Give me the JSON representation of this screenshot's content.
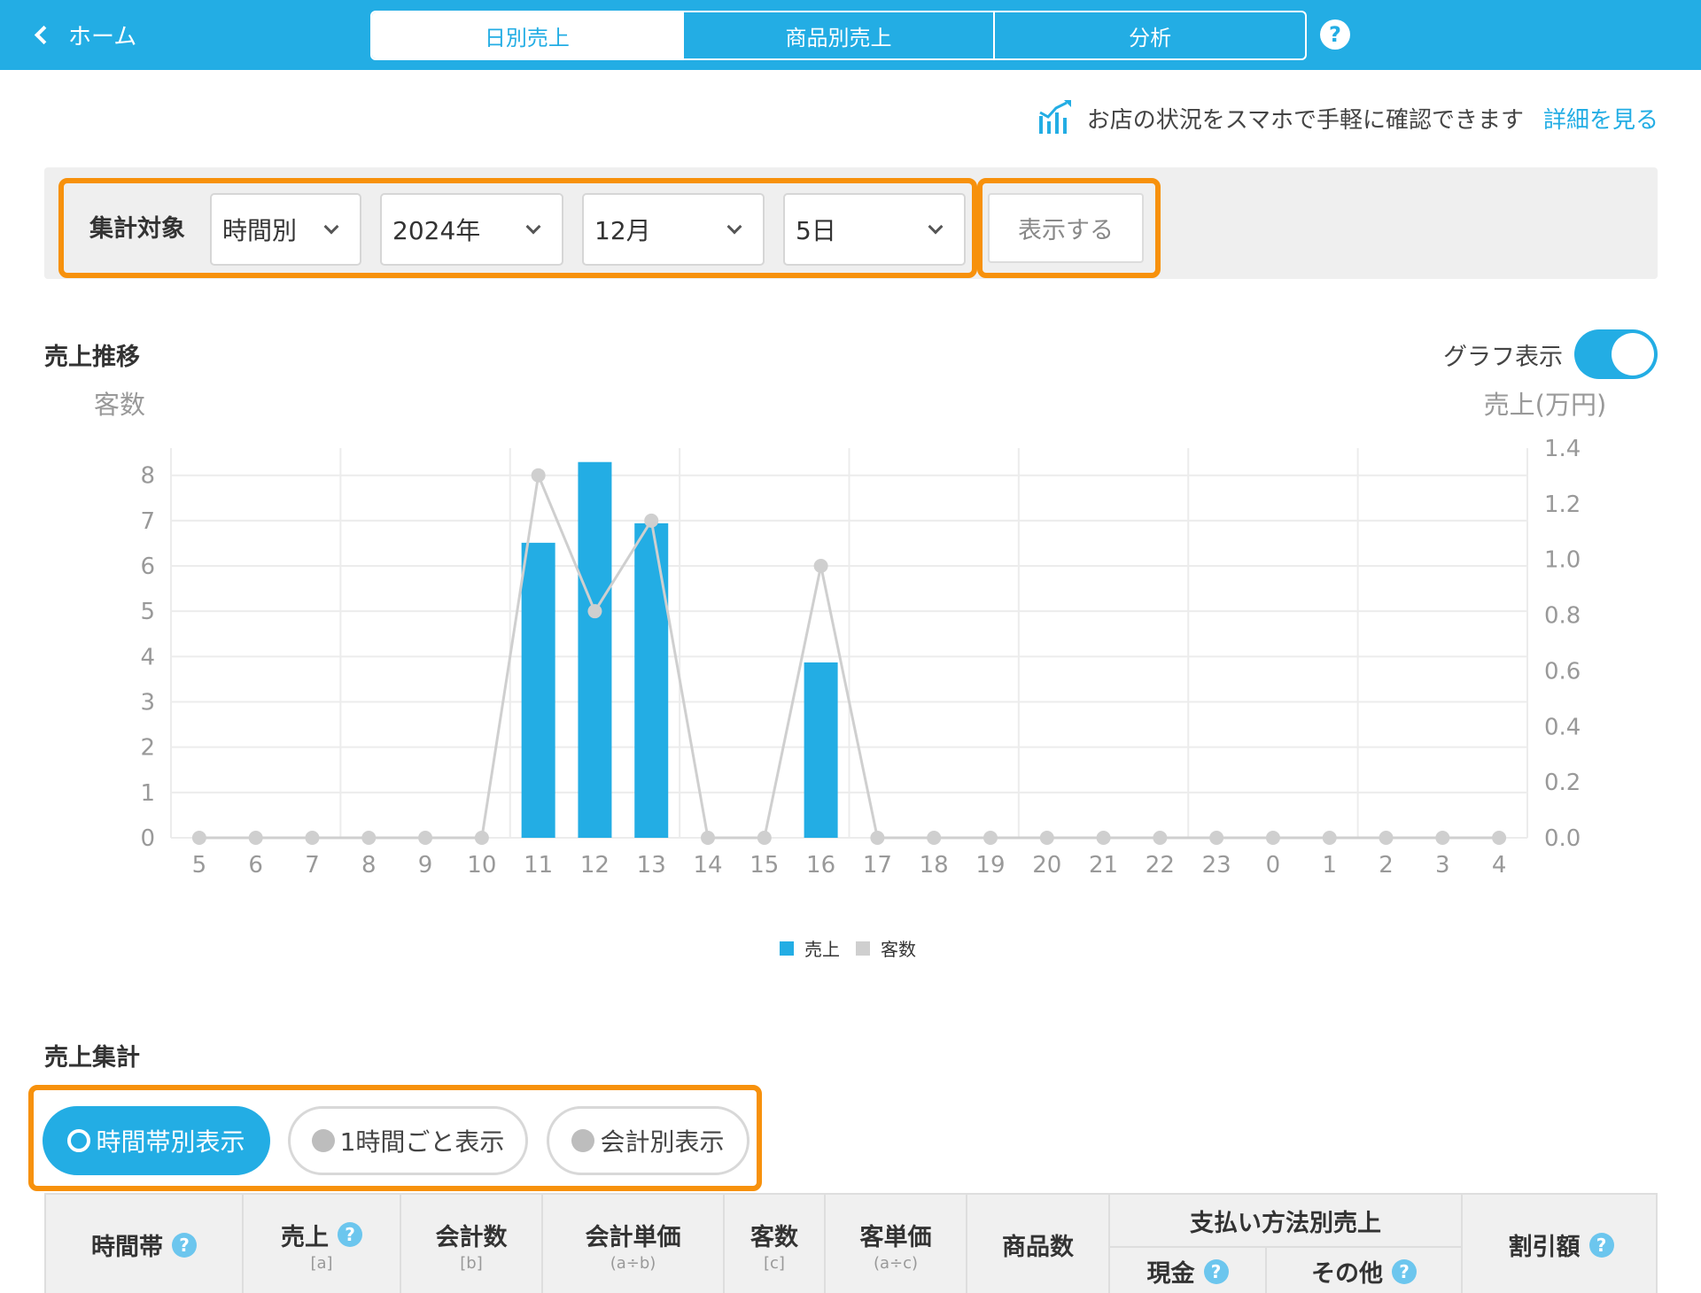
{
  "header": {
    "back_label": "ホーム",
    "tabs": [
      {
        "label": "日別売上",
        "active": true
      },
      {
        "label": "商品別売上",
        "active": false
      },
      {
        "label": "分析",
        "active": false
      }
    ],
    "help_label": "?"
  },
  "promo": {
    "text": "お店の状況をスマホで手軽に確認できます",
    "link_label": "詳細を見る"
  },
  "filter": {
    "label": "集計対象",
    "selects": {
      "mode": "時間別",
      "year": "2024年",
      "month": "12月",
      "day": "5日"
    },
    "show_button": "表示する"
  },
  "trend": {
    "title": "売上推移",
    "toggle_label": "グラフ表示",
    "toggle_on": true
  },
  "colors": {
    "accent": "#23ade4",
    "highlight": "#f7910c",
    "customer_line": "#cfcfcf"
  },
  "chart_data": {
    "type": "bar",
    "left_axis_label": "客数",
    "right_axis_label": "売上(万円)",
    "categories": [
      "5",
      "6",
      "7",
      "8",
      "9",
      "10",
      "11",
      "12",
      "13",
      "14",
      "15",
      "16",
      "17",
      "18",
      "19",
      "20",
      "21",
      "22",
      "23",
      "0",
      "1",
      "2",
      "3",
      "4"
    ],
    "series": [
      {
        "name": "売上",
        "type": "bar",
        "axis": "right",
        "values": [
          0,
          0,
          0,
          0,
          0,
          0,
          1.06,
          1.35,
          1.13,
          0,
          0,
          0.63,
          0,
          0,
          0,
          0,
          0,
          0,
          0,
          0,
          0,
          0,
          0,
          0
        ]
      },
      {
        "name": "客数",
        "type": "line",
        "axis": "left",
        "values": [
          0,
          0,
          0,
          0,
          0,
          0,
          8,
          5,
          7,
          0,
          0,
          6,
          0,
          0,
          0,
          0,
          0,
          0,
          0,
          0,
          0,
          0,
          0,
          0
        ]
      }
    ],
    "left_ticks": [
      "0",
      "1",
      "2",
      "3",
      "4",
      "5",
      "6",
      "7",
      "8"
    ],
    "right_ticks": [
      "0.0",
      "0.2",
      "0.4",
      "0.6",
      "0.8",
      "1.0",
      "1.2",
      "1.4"
    ],
    "ylim_left": [
      0,
      8.6
    ],
    "ylim_right": [
      0,
      1.4
    ],
    "grid": true,
    "legend": "bottom-center"
  },
  "summary": {
    "title": "売上集計",
    "modes": [
      {
        "label": "時間帯別表示",
        "active": true
      },
      {
        "label": "1時間ごと表示",
        "active": false
      },
      {
        "label": "会計別表示",
        "active": false
      }
    ]
  },
  "table": {
    "columns": [
      {
        "label": "時間帯",
        "sub": "",
        "help": true
      },
      {
        "label": "売上",
        "sub": "[a]",
        "help": true
      },
      {
        "label": "会計数",
        "sub": "[b]",
        "help": false
      },
      {
        "label": "会計単価",
        "sub": "(a÷b)",
        "help": false
      },
      {
        "label": "客数",
        "sub": "[c]",
        "help": false
      },
      {
        "label": "客単価",
        "sub": "(a÷c)",
        "help": false
      },
      {
        "label": "商品数",
        "sub": "",
        "help": false
      },
      {
        "label": "割引額",
        "sub": "",
        "help": true
      }
    ],
    "payment_group": "支払い方法別売上",
    "payment_sub": [
      {
        "label": "現金",
        "help": true
      },
      {
        "label": "その他",
        "help": true
      }
    ]
  }
}
